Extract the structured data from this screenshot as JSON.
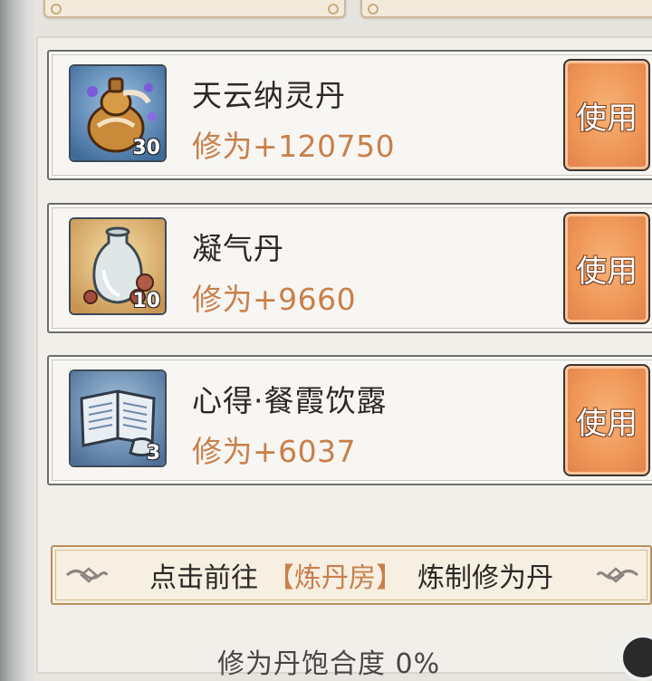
{
  "items": [
    {
      "name": "天云纳灵丹",
      "effect": "修为+120750",
      "count": "30",
      "icon": "gourd-pill-icon",
      "button": "使用"
    },
    {
      "name": "凝气丹",
      "effect": "修为+9660",
      "count": "10",
      "icon": "vase-pill-icon",
      "button": "使用"
    },
    {
      "name": "心得·餐霞饮露",
      "effect": "修为+6037",
      "count": "3",
      "icon": "scroll-book-icon",
      "button": "使用"
    }
  ],
  "banner": {
    "prefix": "点击前往",
    "highlight": "【炼丹房】",
    "suffix": "炼制修为丹"
  },
  "footer": {
    "partial_text": "修为丹饱合度 0%"
  },
  "colors": {
    "accent": "#c97f4a",
    "button": "#ef9758",
    "text": "#2b2825"
  }
}
